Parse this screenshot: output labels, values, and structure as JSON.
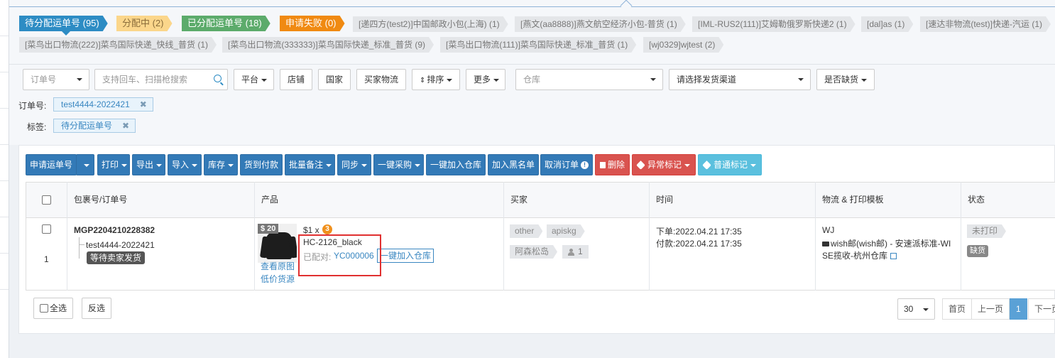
{
  "tabs": [
    {
      "label": "待分配运单号 (95)"
    },
    {
      "label": "分配中 (2)"
    },
    {
      "label": "已分配运单号 (18)"
    },
    {
      "label": "申请失败 (0)"
    }
  ],
  "channels": [
    "[递四方(test2)]中国邮政小包(上海) (1)",
    "[燕文(aa8888)]燕文航空经济小包-普货 (1)",
    "[IML-RUS2(111)]艾姆勒俄罗斯快递2 (1)",
    "[dal]as (1)",
    "[速达非物流(test)]快递-汽运 (1)",
    "[菜鸟出口物流(222)]菜鸟国际快递_快线_普货 (1)",
    "[菜鸟出口物流(333333)]菜鸟国际快递_标准_普货 (9)",
    "[菜鸟出口物流(111)]菜鸟国际快递_标准_普货 (1)",
    "[wj0329]wjtest (2)"
  ],
  "filters": {
    "order_type": "订单号",
    "search_placeholder": "支持回车、扫描枪搜索",
    "platform": "平台",
    "shop": "店铺",
    "country": "国家",
    "buyer_logistics": "买家物流",
    "sort": "排序",
    "more": "更多",
    "warehouse_placeholder": "仓库",
    "channel_placeholder": "请选择发货渠道",
    "out_of_stock": "是否缺货",
    "order_label": "订单号:",
    "order_value": "test4444-2022421",
    "tag_label": "标签:",
    "tag_value": "待分配运单号"
  },
  "toolbar": {
    "apply": "申请运单号",
    "print": "打印",
    "export": "导出",
    "import": "导入",
    "stock": "库存",
    "cod": "货到付款",
    "batch_note": "批量备注",
    "sync": "同步",
    "purchase": "一键采购",
    "add_warehouse": "一键加入仓库",
    "blacklist": "加入黑名单",
    "cancel": "取消订单",
    "delete": "删除",
    "abnormal": "异常标记",
    "normal": "普通标记"
  },
  "table": {
    "headers": {
      "package": "包裹号/订单号",
      "product": "产品",
      "buyer": "买家",
      "time": "时间",
      "logistics": "物流 & 打印模板",
      "status": "状态"
    },
    "row": {
      "index": "1",
      "package_no": "MGP2204210228382",
      "order_no": "test4444-2022421",
      "wait_badge": "等待卖家发货",
      "price_badge": "$ 20",
      "price_qty": "$1 x",
      "qty": "3",
      "sku": "HC-2126_black",
      "matched_label": "已配对:",
      "matched_value": "YC000006",
      "add_warehouse_btn": "一键加入仓库",
      "view_image": "查看原图",
      "low_price_source": "低价货源",
      "buyer_tag1": "other",
      "buyer_tag2": "apiskg",
      "buyer_name": "阿森松岛",
      "buyer_count": "1",
      "order_time": "下单:2022.04.21 17:35",
      "pay_time": "付款:2022.04.21 17:35",
      "carrier": "WJ",
      "service_line1": "wish邮(wish邮) - 安速派标准-WI",
      "service_line2": "SE揽收-杭州仓库",
      "print_status": "未打印",
      "stock_status": "缺货"
    }
  },
  "footer": {
    "select_all": "全选",
    "invert": "反选",
    "page_size": "30",
    "first": "首页",
    "prev": "上一页",
    "current": "1",
    "next": "下一页"
  }
}
